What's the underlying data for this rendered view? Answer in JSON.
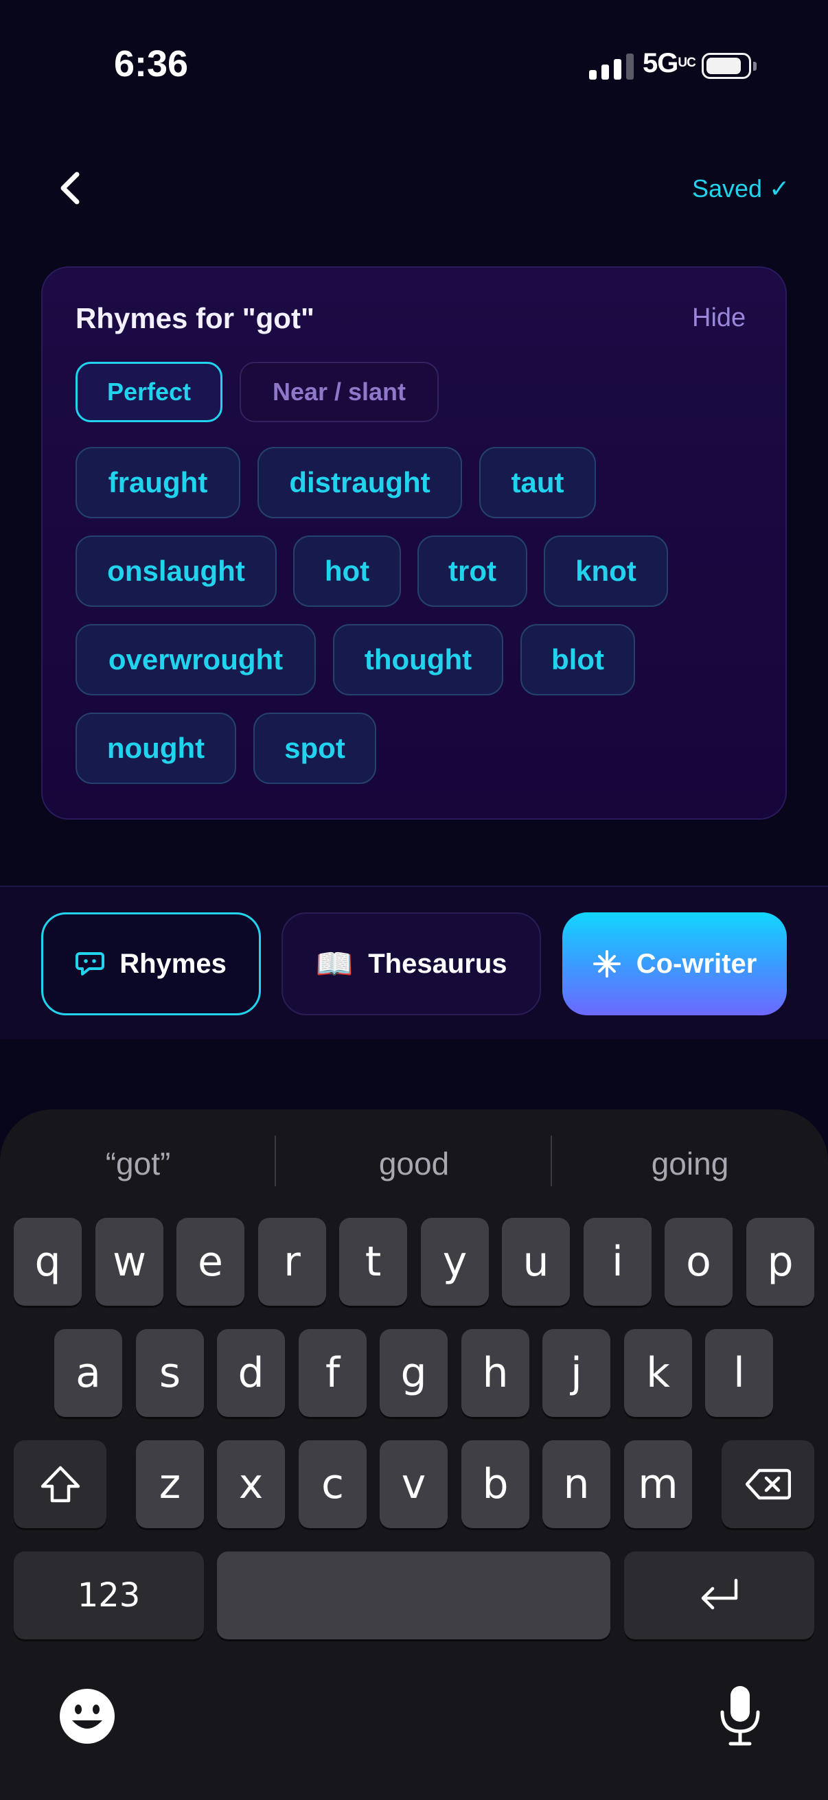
{
  "status_bar": {
    "time": "6:36",
    "network": "5G",
    "network_suffix": "UC"
  },
  "nav": {
    "saved_label": "Saved ✓"
  },
  "rhymes_panel": {
    "title": "Rhymes for \"got\"",
    "hide_label": "Hide",
    "modes": [
      "Perfect",
      "Near / slant"
    ],
    "selected_mode": "Perfect",
    "words": [
      "fraught",
      "distraught",
      "taut",
      "onslaught",
      "hot",
      "trot",
      "knot",
      "overwrought",
      "thought",
      "blot",
      "nought",
      "spot"
    ]
  },
  "toolbar": {
    "rhymes_label": "Rhymes",
    "thesaurus_label": "Thesaurus",
    "cowriter_label": "Co-writer",
    "book_icon": "📖"
  },
  "keyboard": {
    "suggestions": [
      "“got”",
      "good",
      "going"
    ],
    "row1": [
      "q",
      "w",
      "e",
      "r",
      "t",
      "y",
      "u",
      "i",
      "o",
      "p"
    ],
    "row2": [
      "a",
      "s",
      "d",
      "f",
      "g",
      "h",
      "j",
      "k",
      "l"
    ],
    "row3": [
      "z",
      "x",
      "c",
      "v",
      "b",
      "n",
      "m"
    ],
    "numbers_label": "123"
  },
  "colors": {
    "accent": "#22d3ee",
    "background": "#07061a",
    "panel": "#1c0b44",
    "muted_purple": "#9b86dc"
  }
}
